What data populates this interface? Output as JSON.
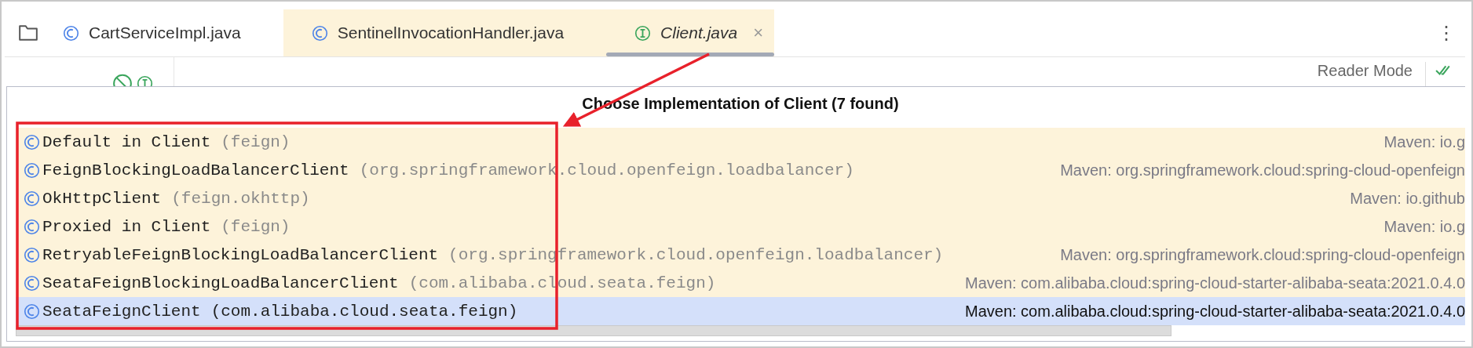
{
  "tabs": [
    {
      "label": "CartServiceImpl.java",
      "kind": "class",
      "selected": false,
      "highlighted": false,
      "preview": false
    },
    {
      "label": "SentinelInvocationHandler.java",
      "kind": "class",
      "selected": false,
      "highlighted": true,
      "preview": false
    },
    {
      "label": "Client.java",
      "kind": "interface",
      "selected": true,
      "highlighted": true,
      "preview": true,
      "close": "×"
    }
  ],
  "more_menu": "⋮",
  "reader_mode": "Reader Mode",
  "popup": {
    "title": "Choose Implementation of Client (7 found)",
    "rows": [
      {
        "name": "Default in Client",
        "package": "(feign)",
        "location": "Maven: io.g",
        "selected": false
      },
      {
        "name": "FeignBlockingLoadBalancerClient",
        "package": "(org.springframework.cloud.openfeign.loadbalancer)",
        "location": "Maven: org.springframework.cloud:spring-cloud-openfeign",
        "selected": false
      },
      {
        "name": "OkHttpClient",
        "package": "(feign.okhttp)",
        "location": "Maven: io.github",
        "selected": false
      },
      {
        "name": "Proxied in Client",
        "package": "(feign)",
        "location": "Maven: io.g",
        "selected": false
      },
      {
        "name": "RetryableFeignBlockingLoadBalancerClient",
        "package": "(org.springframework.cloud.openfeign.loadbalancer)",
        "location": "Maven: org.springframework.cloud:spring-cloud-openfeign",
        "selected": false
      },
      {
        "name": "SeataFeignBlockingLoadBalancerClient",
        "package": "(com.alibaba.cloud.seata.feign)",
        "location": "Maven: com.alibaba.cloud:spring-cloud-starter-alibaba-seata:2021.0.4.0",
        "selected": false
      },
      {
        "name": "SeataFeignClient",
        "package": "(com.alibaba.cloud.seata.feign)",
        "location": "Maven: com.alibaba.cloud:spring-cloud-starter-alibaba-seata:2021.0.4.0",
        "selected": true
      }
    ]
  }
}
